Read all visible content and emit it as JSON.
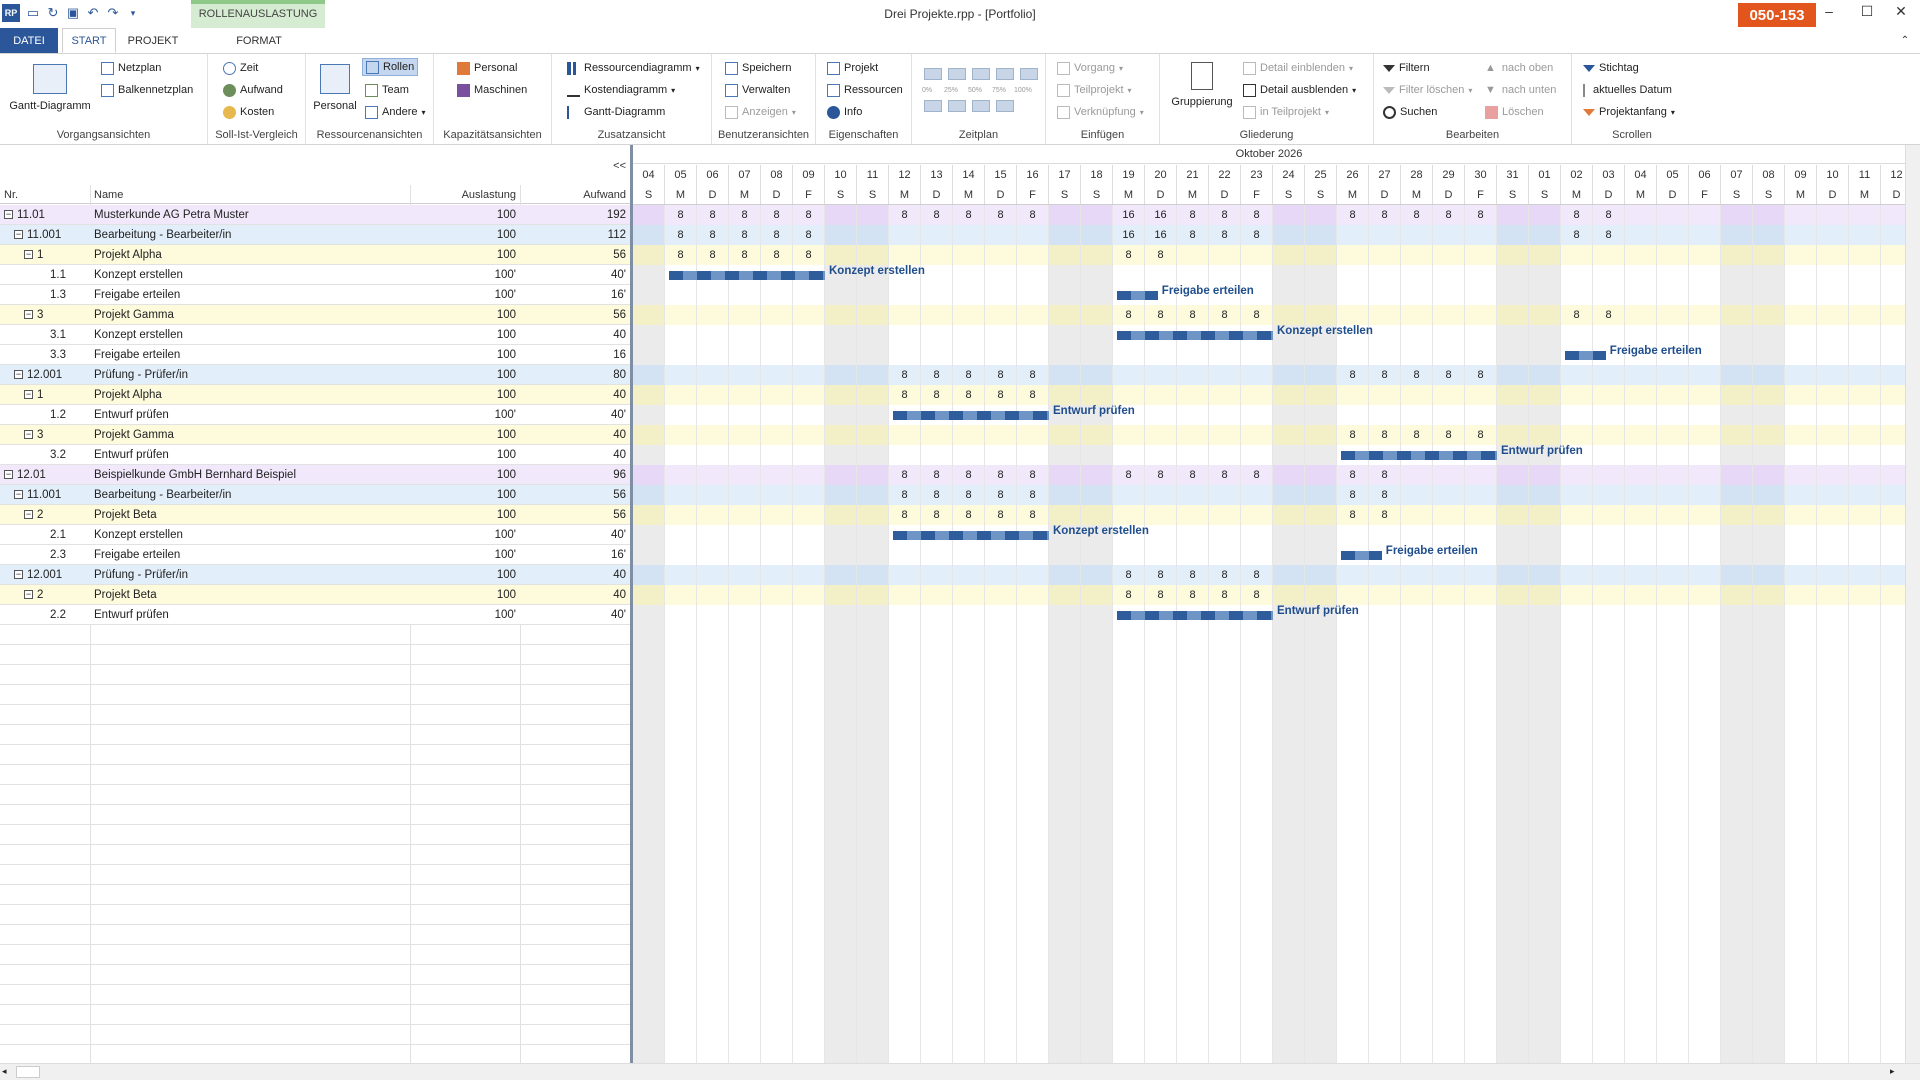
{
  "window": {
    "title": "Drei Projekte.rpp - [Portfolio]",
    "badge": "050-153",
    "minimize": "–",
    "maximize": "☐",
    "close": "✕",
    "appicon": "RP"
  },
  "tabs": {
    "file": "DATEI",
    "start": "START",
    "project": "PROJEKT",
    "context": "ROLLENAUSLASTUNG",
    "format": "FORMAT"
  },
  "ribbon": {
    "vorgang": {
      "label": "Vorgangsansichten",
      "gantt": "Gantt-Diagramm",
      "netzplan": "Netzplan",
      "balken": "Balkennetzplan"
    },
    "sollist": {
      "label": "Soll-Ist-Vergleich",
      "zeit": "Zeit",
      "aufwand": "Aufwand",
      "kosten": "Kosten"
    },
    "ressource": {
      "label": "Ressourcenansichten",
      "personal": "Personal",
      "rollen": "Rollen",
      "team": "Team",
      "andere": "Andere"
    },
    "kapazitaet": {
      "label": "Kapazitätsansichten",
      "personal": "Personal",
      "maschinen": "Maschinen"
    },
    "zusatz": {
      "label": "Zusatzansicht",
      "ressdia": "Ressourcendiagramm",
      "kostendia": "Kostendiagramm",
      "gantt": "Gantt-Diagramm"
    },
    "benutzer": {
      "label": "Benutzeransichten",
      "speichern": "Speichern",
      "verwalten": "Verwalten",
      "anzeigen": "Anzeigen"
    },
    "eigen": {
      "label": "Eigenschaften",
      "projekt": "Projekt",
      "ressourcen": "Ressourcen",
      "info": "Info"
    },
    "zeitplan": {
      "label": "Zeitplan",
      "zooms": [
        "0%",
        "25%",
        "50%",
        "75%",
        "100%"
      ]
    },
    "einfuegen": {
      "label": "Einfügen",
      "vorgang": "Vorgang",
      "teilprojekt": "Teilprojekt",
      "verkn": "Verknüpfung"
    },
    "gliederung": {
      "label": "Gliederung",
      "gruppierung": "Gruppierung",
      "einblenden": "Detail einblenden",
      "ausblenden": "Detail ausblenden",
      "inteil": "in Teilprojekt"
    },
    "bearbeiten": {
      "label": "Bearbeiten",
      "filtern": "Filtern",
      "filterloeschen": "Filter löschen",
      "suchen": "Suchen",
      "oben": "nach oben",
      "unten": "nach unten",
      "loeschen": "Löschen"
    },
    "scrollen": {
      "label": "Scrollen",
      "stichtag": "Stichtag",
      "aktuell": "aktuelles Datum",
      "projektanfang": "Projektanfang"
    }
  },
  "grid": {
    "collapse": "<<",
    "columns": {
      "nr": "Nr.",
      "name": "Name",
      "auslastung": "Auslastung",
      "aufwand": "Aufwand"
    },
    "month": "Oktober 2026",
    "dates": [
      "04",
      "05",
      "06",
      "07",
      "08",
      "09",
      "10",
      "11",
      "12",
      "13",
      "14",
      "15",
      "16",
      "17",
      "18",
      "19",
      "20",
      "21",
      "22",
      "23",
      "24",
      "25",
      "26",
      "27",
      "28",
      "29",
      "30",
      "31",
      "01",
      "02",
      "03",
      "04",
      "05",
      "06",
      "07",
      "08",
      "09",
      "10",
      "11",
      "12"
    ],
    "weekdays": [
      "S",
      "M",
      "D",
      "M",
      "D",
      "F",
      "S",
      "S",
      "M",
      "D",
      "M",
      "D",
      "F",
      "S",
      "S",
      "M",
      "D",
      "M",
      "D",
      "F",
      "S",
      "S",
      "M",
      "D",
      "M",
      "D",
      "F",
      "S",
      "S",
      "M",
      "D",
      "M",
      "D",
      "F",
      "S",
      "S",
      "M",
      "D",
      "M",
      "D"
    ],
    "rows": [
      {
        "nr": "11.01",
        "name": "Musterkunde AG Petra Muster",
        "ausl": "100",
        "aufw": "192",
        "level": 0,
        "exp": true,
        "bg": "#f1e8fb",
        "vals": {
          "1": "8",
          "2": "8",
          "3": "8",
          "4": "8",
          "5": "8",
          "8": "8",
          "9": "8",
          "10": "8",
          "11": "8",
          "12": "8",
          "15": "16",
          "16": "16",
          "17": "8",
          "18": "8",
          "19": "8",
          "22": "8",
          "23": "8",
          "24": "8",
          "25": "8",
          "26": "8",
          "29": "8",
          "30": "8"
        }
      },
      {
        "nr": "11.001",
        "name": "Bearbeitung - Bearbeiter/in",
        "ausl": "100",
        "aufw": "112",
        "level": 1,
        "exp": true,
        "bg": "#e2eef9",
        "vals": {
          "1": "8",
          "2": "8",
          "3": "8",
          "4": "8",
          "5": "8",
          "15": "16",
          "16": "16",
          "17": "8",
          "18": "8",
          "19": "8",
          "29": "8",
          "30": "8"
        }
      },
      {
        "nr": "1",
        "name": "Projekt Alpha",
        "ausl": "100",
        "aufw": "56",
        "level": 2,
        "exp": true,
        "bg": "#fdfbdc",
        "vals": {
          "1": "8",
          "2": "8",
          "3": "8",
          "4": "8",
          "5": "8",
          "15": "8",
          "16": "8"
        }
      },
      {
        "nr": "1.1",
        "name": "Konzept erstellen",
        "ausl": "100'",
        "aufw": "40'",
        "level": 3,
        "bg": "#fff",
        "bar": {
          "start": 1,
          "end": 6,
          "label": "Konzept erstellen"
        }
      },
      {
        "nr": "1.3",
        "name": "Freigabe erteilen",
        "ausl": "100'",
        "aufw": "16'",
        "level": 3,
        "bg": "#fff",
        "bar": {
          "start": 15,
          "end": 16.4,
          "label": "Freigabe erteilen"
        }
      },
      {
        "nr": "3",
        "name": "Projekt Gamma",
        "ausl": "100",
        "aufw": "56",
        "level": 2,
        "exp": true,
        "bg": "#fdfbdc",
        "vals": {
          "15": "8",
          "16": "8",
          "17": "8",
          "18": "8",
          "19": "8",
          "29": "8",
          "30": "8"
        }
      },
      {
        "nr": "3.1",
        "name": "Konzept erstellen",
        "ausl": "100",
        "aufw": "40",
        "level": 3,
        "bg": "#fff",
        "bar": {
          "start": 15,
          "end": 20,
          "label": "Konzept erstellen"
        }
      },
      {
        "nr": "3.3",
        "name": "Freigabe erteilen",
        "ausl": "100",
        "aufw": "16",
        "level": 3,
        "bg": "#fff",
        "bar": {
          "start": 29,
          "end": 30.4,
          "label": "Freigabe erteilen"
        }
      },
      {
        "nr": "12.001",
        "name": "Prüfung - Prüfer/in",
        "ausl": "100",
        "aufw": "80",
        "level": 1,
        "exp": true,
        "bg": "#e2eef9",
        "vals": {
          "8": "8",
          "9": "8",
          "10": "8",
          "11": "8",
          "12": "8",
          "22": "8",
          "23": "8",
          "24": "8",
          "25": "8",
          "26": "8"
        }
      },
      {
        "nr": "1",
        "name": "Projekt Alpha",
        "ausl": "100",
        "aufw": "40",
        "level": 2,
        "exp": true,
        "bg": "#fdfbdc",
        "vals": {
          "8": "8",
          "9": "8",
          "10": "8",
          "11": "8",
          "12": "8"
        }
      },
      {
        "nr": "1.2",
        "name": "Entwurf prüfen",
        "ausl": "100'",
        "aufw": "40'",
        "level": 3,
        "bg": "#fff",
        "bar": {
          "start": 8,
          "end": 13,
          "label": "Entwurf prüfen"
        }
      },
      {
        "nr": "3",
        "name": "Projekt Gamma",
        "ausl": "100",
        "aufw": "40",
        "level": 2,
        "exp": true,
        "bg": "#fdfbdc",
        "vals": {
          "22": "8",
          "23": "8",
          "24": "8",
          "25": "8",
          "26": "8"
        }
      },
      {
        "nr": "3.2",
        "name": "Entwurf prüfen",
        "ausl": "100",
        "aufw": "40",
        "level": 3,
        "bg": "#fff",
        "bar": {
          "start": 22,
          "end": 27,
          "label": "Entwurf prüfen"
        }
      },
      {
        "nr": "12.01",
        "name": "Beispielkunde GmbH Bernhard Beispiel",
        "ausl": "100",
        "aufw": "96",
        "level": 0,
        "exp": true,
        "bg": "#f1e8fb",
        "vals": {
          "8": "8",
          "9": "8",
          "10": "8",
          "11": "8",
          "12": "8",
          "15": "8",
          "16": "8",
          "17": "8",
          "18": "8",
          "19": "8",
          "22": "8",
          "23": "8"
        }
      },
      {
        "nr": "11.001",
        "name": "Bearbeitung - Bearbeiter/in",
        "ausl": "100",
        "aufw": "56",
        "level": 1,
        "exp": true,
        "bg": "#e2eef9",
        "vals": {
          "8": "8",
          "9": "8",
          "10": "8",
          "11": "8",
          "12": "8",
          "22": "8",
          "23": "8"
        }
      },
      {
        "nr": "2",
        "name": "Projekt Beta",
        "ausl": "100",
        "aufw": "56",
        "level": 2,
        "exp": true,
        "bg": "#fdfbdc",
        "vals": {
          "8": "8",
          "9": "8",
          "10": "8",
          "11": "8",
          "12": "8",
          "22": "8",
          "23": "8"
        }
      },
      {
        "nr": "2.1",
        "name": "Konzept erstellen",
        "ausl": "100'",
        "aufw": "40'",
        "level": 3,
        "bg": "#fff",
        "bar": {
          "start": 8,
          "end": 13,
          "label": "Konzept erstellen"
        }
      },
      {
        "nr": "2.3",
        "name": "Freigabe erteilen",
        "ausl": "100'",
        "aufw": "16'",
        "level": 3,
        "bg": "#fff",
        "bar": {
          "start": 22,
          "end": 23.4,
          "label": "Freigabe erteilen"
        }
      },
      {
        "nr": "12.001",
        "name": "Prüfung - Prüfer/in",
        "ausl": "100",
        "aufw": "40",
        "level": 1,
        "exp": true,
        "bg": "#e2eef9",
        "vals": {
          "15": "8",
          "16": "8",
          "17": "8",
          "18": "8",
          "19": "8"
        }
      },
      {
        "nr": "2",
        "name": "Projekt Beta",
        "ausl": "100",
        "aufw": "40",
        "level": 2,
        "exp": true,
        "bg": "#fdfbdc",
        "vals": {
          "15": "8",
          "16": "8",
          "17": "8",
          "18": "8",
          "19": "8"
        }
      },
      {
        "nr": "2.2",
        "name": "Entwurf prüfen",
        "ausl": "100'",
        "aufw": "40'",
        "level": 3,
        "bg": "#fff",
        "bar": {
          "start": 15,
          "end": 20,
          "label": "Entwurf prüfen"
        }
      }
    ]
  }
}
